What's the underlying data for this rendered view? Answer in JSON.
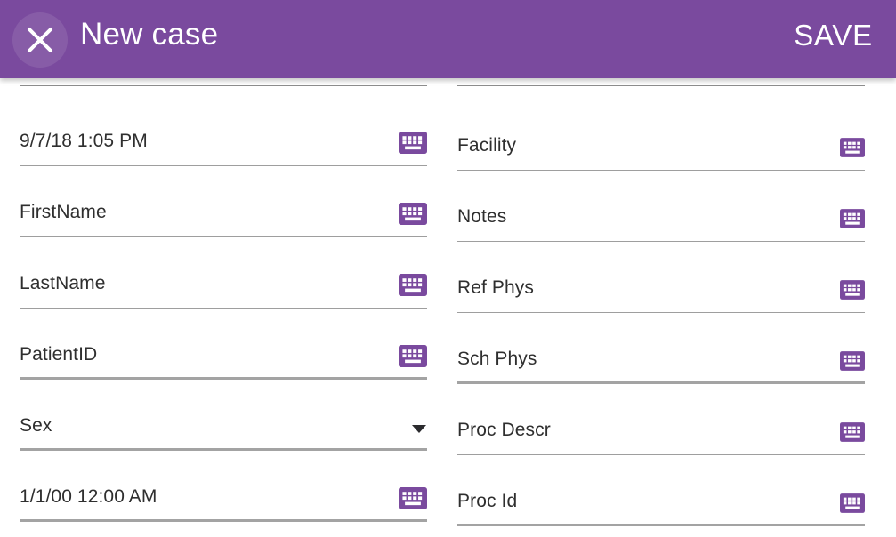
{
  "header": {
    "title": "New case",
    "save_label": "SAVE",
    "close_icon": "close-icon",
    "background_color": "#7a4a9e",
    "text_color": "#ffffff"
  },
  "form": {
    "keyboard_icon": "keyboard-icon",
    "dropdown_icon": "chevron-down-icon",
    "icon_color": "#7a4a9e",
    "left_column": [
      {
        "name": "scheduled-datetime",
        "label": "9/7/18 1:05 PM",
        "control": "keyboard",
        "underline": "normal"
      },
      {
        "name": "first-name",
        "label": "FirstName",
        "control": "keyboard",
        "underline": "normal"
      },
      {
        "name": "last-name",
        "label": "LastName",
        "control": "keyboard",
        "underline": "normal"
      },
      {
        "name": "patient-id",
        "label": "PatientID",
        "control": "keyboard",
        "underline": "strong"
      },
      {
        "name": "sex",
        "label": "Sex",
        "control": "dropdown",
        "underline": "strong"
      },
      {
        "name": "birth-datetime",
        "label": "1/1/00 12:00 AM",
        "control": "keyboard",
        "underline": "strong"
      }
    ],
    "right_column": [
      {
        "name": "facility",
        "label": "Facility",
        "control": "keyboard",
        "underline": "normal"
      },
      {
        "name": "notes",
        "label": "Notes",
        "control": "keyboard",
        "underline": "normal"
      },
      {
        "name": "ref-phys",
        "label": "Ref Phys",
        "control": "keyboard",
        "underline": "normal"
      },
      {
        "name": "sch-phys",
        "label": "Sch Phys",
        "control": "keyboard",
        "underline": "strong"
      },
      {
        "name": "proc-descr",
        "label": "Proc Descr",
        "control": "keyboard",
        "underline": "normal"
      },
      {
        "name": "proc-id",
        "label": "Proc Id",
        "control": "keyboard",
        "underline": "strong"
      }
    ]
  }
}
